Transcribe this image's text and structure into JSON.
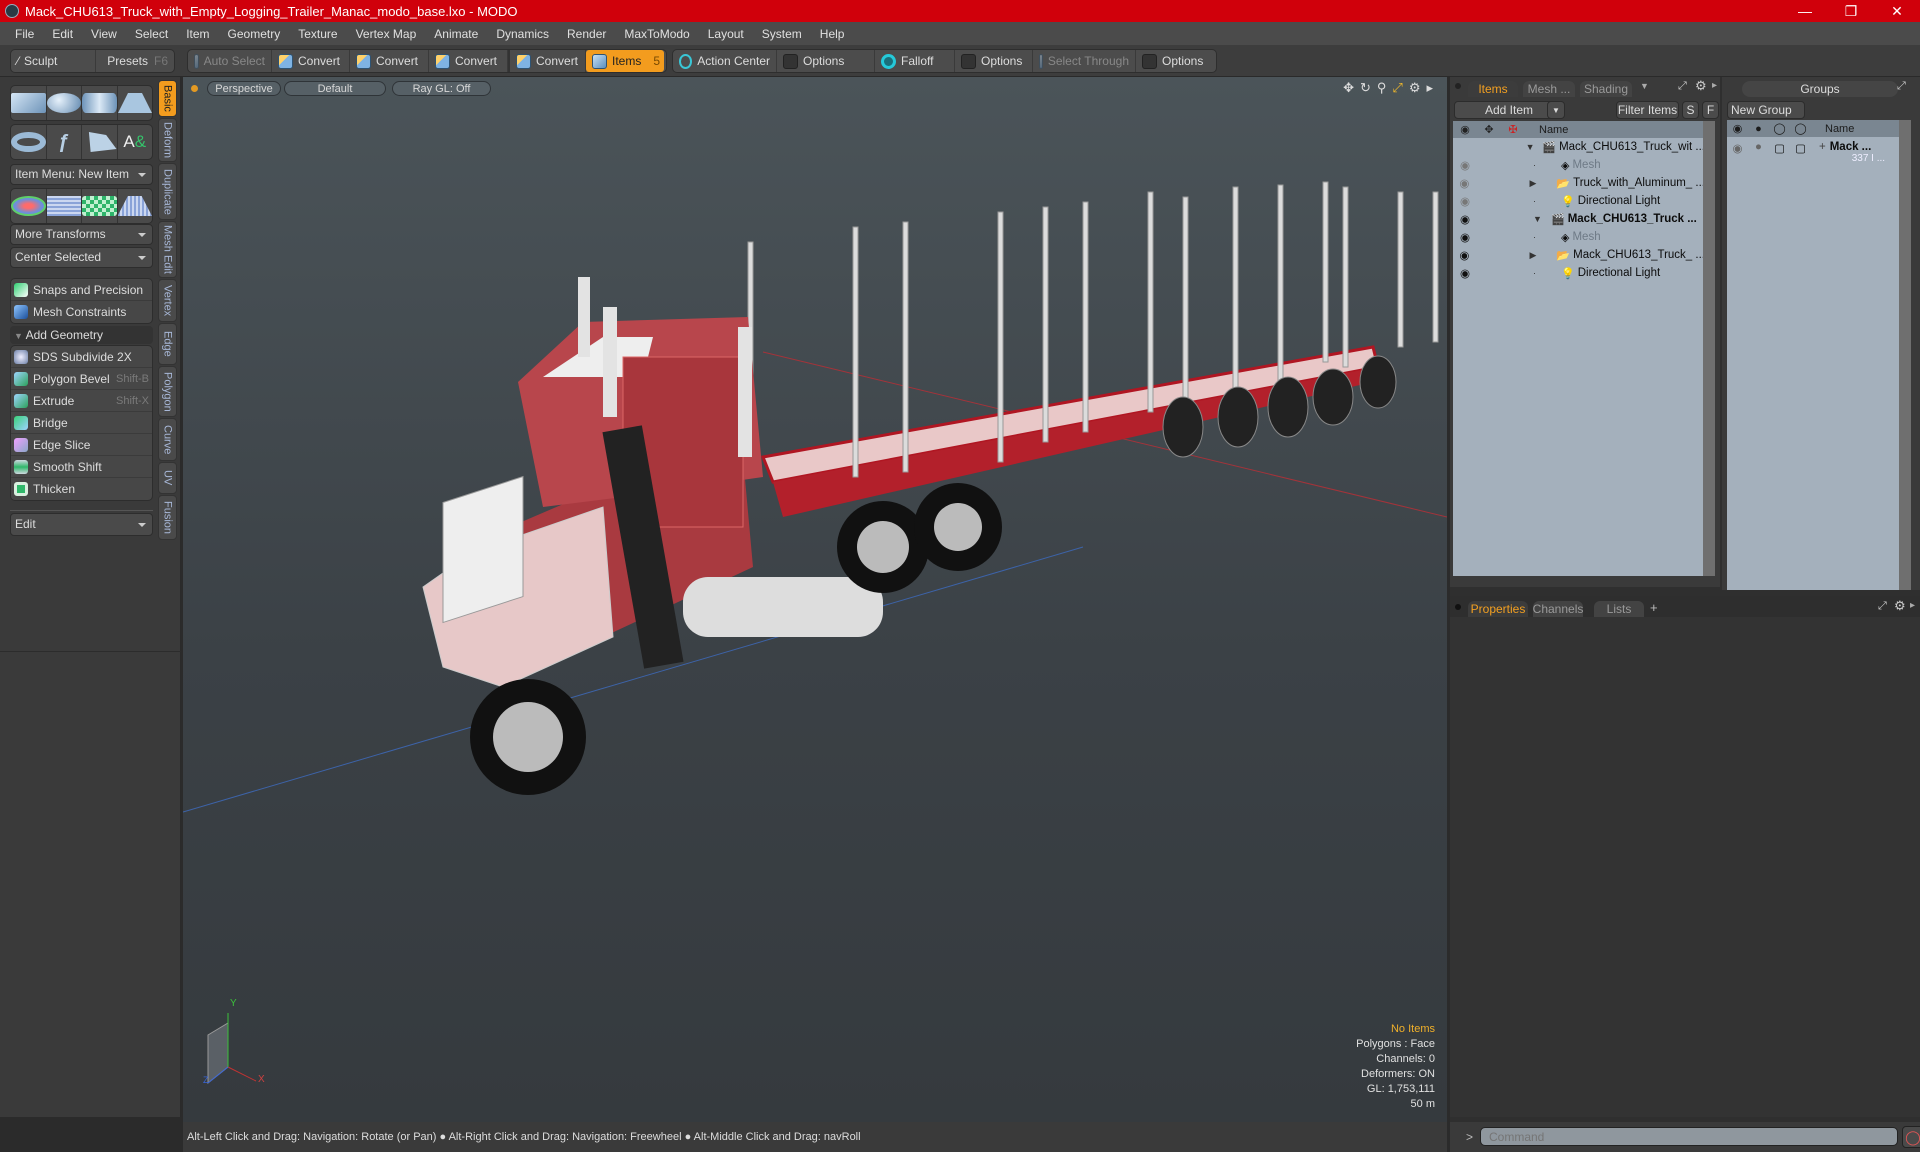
{
  "window": {
    "title": "Mack_CHU613_Truck_with_Empty_Logging_Trailer_Manac_modo_base.lxo - MODO",
    "controls": [
      "minimize",
      "maximize",
      "close"
    ]
  },
  "menu": [
    "File",
    "Edit",
    "View",
    "Select",
    "Item",
    "Geometry",
    "Texture",
    "Vertex Map",
    "Animate",
    "Dynamics",
    "Render",
    "MaxToModo",
    "Layout",
    "System",
    "Help"
  ],
  "toolbar": {
    "sculpt": "Sculpt",
    "presets": "Presets",
    "presets_key": "F6",
    "auto_select": "Auto Select",
    "convert": [
      "Convert",
      "Convert",
      "Convert",
      "Convert"
    ],
    "items": "Items",
    "items_key": "5",
    "action_center": "Action Center",
    "options1": "Options",
    "falloff": "Falloff",
    "options2": "Options",
    "select_through": "Select Through",
    "options3": "Options"
  },
  "left_panel": {
    "item_menu": "Item Menu: New Item",
    "more_transforms": "More Transforms",
    "center_selected": "Center Selected",
    "snaps": "Snaps and Precision",
    "mesh_constraints": "Mesh Constraints",
    "add_geometry": "Add Geometry",
    "tools": [
      {
        "label": "SDS Subdivide 2X",
        "shortcut": ""
      },
      {
        "label": "Polygon Bevel",
        "shortcut": "Shift-B"
      },
      {
        "label": "Extrude",
        "shortcut": "Shift-X"
      },
      {
        "label": "Bridge",
        "shortcut": ""
      },
      {
        "label": "Edge Slice",
        "shortcut": ""
      },
      {
        "label": "Smooth Shift",
        "shortcut": ""
      },
      {
        "label": "Thicken",
        "shortcut": ""
      }
    ],
    "edit": "Edit",
    "vertical_tabs": [
      "Basic",
      "Deform",
      "Duplicate",
      "Mesh Edit",
      "Vertex",
      "Edge",
      "Polygon",
      "Curve",
      "UV",
      "Fusion"
    ]
  },
  "viewport": {
    "view": "Perspective",
    "shading": "Default",
    "raygl": "Ray GL: Off",
    "info": {
      "selection": "No Items",
      "polygons": "Polygons : Face",
      "channels": "Channels: 0",
      "deformers": "Deformers: ON",
      "gl": "GL: 1,753,111",
      "scale": "50 m"
    },
    "axis": {
      "x": "X",
      "y": "Y",
      "z": "Z"
    }
  },
  "status_bar": "Alt-Left Click and Drag: Navigation: Rotate (or Pan) ● Alt-Right Click and Drag: Navigation: Freewheel ● Alt-Middle Click and Drag: navRoll",
  "items_panel": {
    "tabs": [
      "Items",
      "Mesh ...",
      "Shading"
    ],
    "add_item": "Add Item",
    "filter_items": "Filter Items",
    "s": "S",
    "f": "F",
    "name_header": "Name",
    "rows": [
      {
        "label": "Mack_CHU613_Truck_wit ...",
        "type": "scene",
        "bold": false,
        "dim": false
      },
      {
        "label": "Mesh",
        "type": "mesh",
        "bold": false,
        "dim": true
      },
      {
        "label": "Truck_with_Aluminum_ ...",
        "type": "group",
        "bold": false,
        "dim": false
      },
      {
        "label": "Directional Light",
        "type": "light",
        "bold": false,
        "dim": false
      },
      {
        "label": "Mack_CHU613_Truck ...",
        "type": "scene",
        "bold": true,
        "dim": false
      },
      {
        "label": "Mesh",
        "type": "mesh",
        "bold": false,
        "dim": true
      },
      {
        "label": "Mack_CHU613_Truck_ ...",
        "type": "group",
        "bold": false,
        "dim": false
      },
      {
        "label": "Directional Light",
        "type": "light",
        "bold": false,
        "dim": false
      }
    ]
  },
  "groups_panel": {
    "title": "Groups",
    "new_group": "New Group",
    "name_header": "Name",
    "row": {
      "label": "Mack ...",
      "sub": "337 I ..."
    }
  },
  "properties_panel": {
    "tabs": [
      "Properties",
      "Channels",
      "Lists",
      "+"
    ]
  },
  "command": {
    "placeholder": "Command",
    "prompt": ">"
  }
}
